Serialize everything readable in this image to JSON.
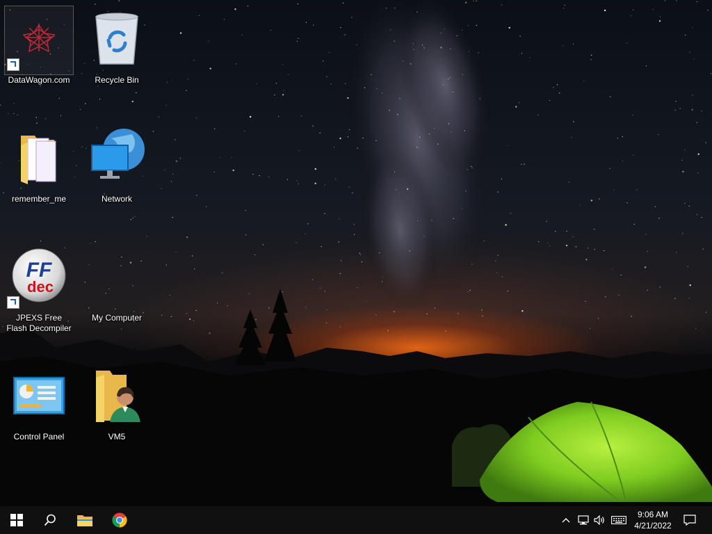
{
  "desktop": {
    "icons": [
      {
        "label": "DataWagon.com",
        "shortcut": true,
        "icon": "datawagon-icon"
      },
      {
        "label": "Recycle Bin",
        "shortcut": false,
        "icon": "recycle-bin-icon"
      },
      {
        "label": "remember_me",
        "shortcut": false,
        "icon": "folder-icon"
      },
      {
        "label": "Network",
        "shortcut": false,
        "icon": "network-icon"
      },
      {
        "label": "JPEXS Free Flash Decompiler",
        "shortcut": true,
        "icon": "ffdec-icon",
        "art_text_top": "FF",
        "art_text_bottom": "dec"
      },
      {
        "label": "My Computer",
        "shortcut": false,
        "icon": "computer-icon"
      },
      {
        "label": "Control Panel",
        "shortcut": false,
        "icon": "control-panel-icon"
      },
      {
        "label": "VM5",
        "shortcut": false,
        "icon": "user-folder-icon"
      }
    ]
  },
  "taskbar": {
    "pinned": [
      {
        "name": "start",
        "icon": "windows-logo-icon"
      },
      {
        "name": "search",
        "icon": "search-icon"
      },
      {
        "name": "file-explorer",
        "icon": "folder-icon"
      },
      {
        "name": "chrome",
        "icon": "chrome-icon"
      }
    ],
    "tray": {
      "icons": [
        "chevron-up-icon",
        "network-icon",
        "volume-icon",
        "keyboard-icon"
      ],
      "time": "9:06 AM",
      "date": "4/21/2022",
      "notification_icon": "notification-icon"
    }
  },
  "colors": {
    "taskbar": "#101010",
    "accent_tent": "#8fd62a",
    "horizon_glow": "#ff6a14"
  }
}
